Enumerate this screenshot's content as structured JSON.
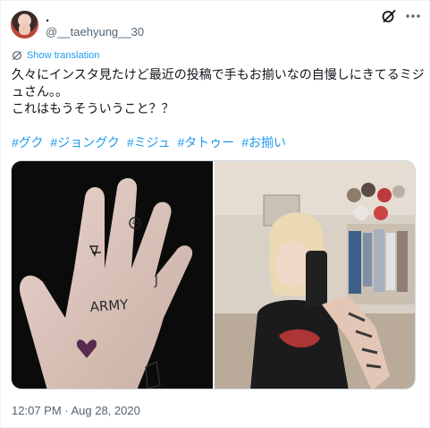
{
  "author": {
    "display_name": ".",
    "handle": "@__taehyung__30"
  },
  "translate": {
    "label": "Show translation"
  },
  "tweet": {
    "lines": [
      "久々にインスタ見たけど最近の投稿で手もお揃いなの自慢しにきてるミジ",
      "ュさん。。",
      "これはもうそういうこと？？"
    ],
    "hashtags": [
      "#グク",
      "#ジョングク",
      "#ミジュ",
      "#タトゥー",
      "#お揃い"
    ]
  },
  "media": {
    "left_image_tattoo_text": "ARMY",
    "left_image_tattoo_letter": "J"
  },
  "timestamp": "12:07 PM · Aug 28, 2020",
  "icons": {
    "grok": "grok-icon",
    "more": "more-icon",
    "translate": "translate-icon"
  },
  "colors": {
    "link": "#1d9bf0",
    "secondary": "#536471"
  }
}
